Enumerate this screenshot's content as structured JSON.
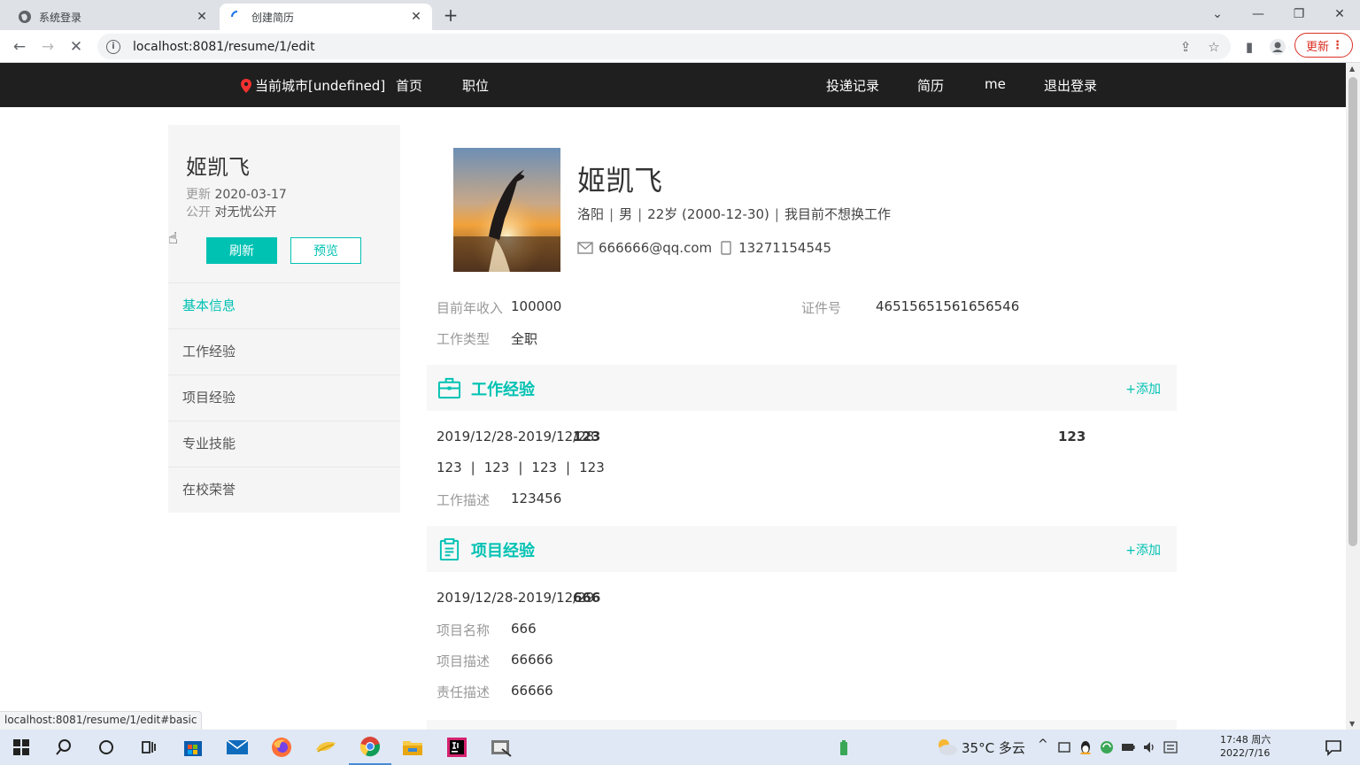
{
  "browser": {
    "tabs": [
      {
        "title": "系统登录",
        "active": false
      },
      {
        "title": "创建简历",
        "active": true
      }
    ],
    "url": "localhost:8081/resume/1/edit",
    "update_label": "更新",
    "status_url": "localhost:8081/resume/1/edit#basic"
  },
  "nav": {
    "city": "当前城市[undefined]",
    "links_left": [
      "首页",
      "职位"
    ],
    "links_right": [
      "投递记录",
      "简历",
      "me",
      "退出登录"
    ]
  },
  "sidebar": {
    "name": "姬凯飞",
    "update_label": "更新",
    "update_date": "2020-03-17",
    "public_label": "公开",
    "public_value": "对无忧公开",
    "refresh_label": "刷新",
    "preview_label": "预览",
    "items": [
      "基本信息",
      "工作经验",
      "项目经验",
      "专业技能",
      "在校荣誉"
    ],
    "active_index": 0
  },
  "profile": {
    "name": "姬凯飞",
    "city": "洛阳",
    "gender": "男",
    "age": "22岁 (2000-12-30)",
    "status": "我目前不想换工作",
    "email": "666666@qq.com",
    "phone": "13271154545",
    "income_label": "目前年收入",
    "income_value": "100000",
    "id_label": "证件号",
    "id_value": "46515651561656546",
    "jobtype_label": "工作类型",
    "jobtype_value": "全职"
  },
  "work": {
    "title": "工作经验",
    "add_label": "+添加",
    "period": "2019/12/28-2019/12/28",
    "company": "123",
    "right_value": "123",
    "details": [
      "123",
      "123",
      "123",
      "123"
    ],
    "desc_label": "工作描述",
    "desc_value": "123456"
  },
  "project": {
    "title": "项目经验",
    "add_label": "+添加",
    "period": "2019/12/28-2019/12/29",
    "name_bold": "666",
    "name_label": "项目名称",
    "name_value": "666",
    "desc_label": "项目描述",
    "desc_value": "66666",
    "resp_label": "责任描述",
    "resp_value": "66666"
  },
  "taskbar": {
    "weather": "35°C 多云",
    "time": "17:48 周六",
    "date": "2022/7/16"
  },
  "colors": {
    "accent": "#00c2b3",
    "nav_bg": "#1f1f1f",
    "update_red": "#d93025"
  }
}
